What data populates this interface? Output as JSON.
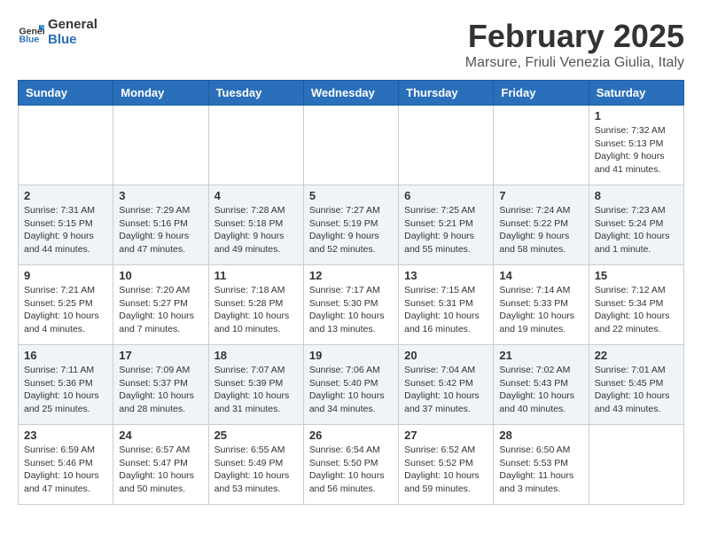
{
  "header": {
    "logo_general": "General",
    "logo_blue": "Blue",
    "month_title": "February 2025",
    "location": "Marsure, Friuli Venezia Giulia, Italy"
  },
  "days_of_week": [
    "Sunday",
    "Monday",
    "Tuesday",
    "Wednesday",
    "Thursday",
    "Friday",
    "Saturday"
  ],
  "weeks": [
    [
      {
        "day": "",
        "info": ""
      },
      {
        "day": "",
        "info": ""
      },
      {
        "day": "",
        "info": ""
      },
      {
        "day": "",
        "info": ""
      },
      {
        "day": "",
        "info": ""
      },
      {
        "day": "",
        "info": ""
      },
      {
        "day": "1",
        "info": "Sunrise: 7:32 AM\nSunset: 5:13 PM\nDaylight: 9 hours and 41 minutes."
      }
    ],
    [
      {
        "day": "2",
        "info": "Sunrise: 7:31 AM\nSunset: 5:15 PM\nDaylight: 9 hours and 44 minutes."
      },
      {
        "day": "3",
        "info": "Sunrise: 7:29 AM\nSunset: 5:16 PM\nDaylight: 9 hours and 47 minutes."
      },
      {
        "day": "4",
        "info": "Sunrise: 7:28 AM\nSunset: 5:18 PM\nDaylight: 9 hours and 49 minutes."
      },
      {
        "day": "5",
        "info": "Sunrise: 7:27 AM\nSunset: 5:19 PM\nDaylight: 9 hours and 52 minutes."
      },
      {
        "day": "6",
        "info": "Sunrise: 7:25 AM\nSunset: 5:21 PM\nDaylight: 9 hours and 55 minutes."
      },
      {
        "day": "7",
        "info": "Sunrise: 7:24 AM\nSunset: 5:22 PM\nDaylight: 9 hours and 58 minutes."
      },
      {
        "day": "8",
        "info": "Sunrise: 7:23 AM\nSunset: 5:24 PM\nDaylight: 10 hours and 1 minute."
      }
    ],
    [
      {
        "day": "9",
        "info": "Sunrise: 7:21 AM\nSunset: 5:25 PM\nDaylight: 10 hours and 4 minutes."
      },
      {
        "day": "10",
        "info": "Sunrise: 7:20 AM\nSunset: 5:27 PM\nDaylight: 10 hours and 7 minutes."
      },
      {
        "day": "11",
        "info": "Sunrise: 7:18 AM\nSunset: 5:28 PM\nDaylight: 10 hours and 10 minutes."
      },
      {
        "day": "12",
        "info": "Sunrise: 7:17 AM\nSunset: 5:30 PM\nDaylight: 10 hours and 13 minutes."
      },
      {
        "day": "13",
        "info": "Sunrise: 7:15 AM\nSunset: 5:31 PM\nDaylight: 10 hours and 16 minutes."
      },
      {
        "day": "14",
        "info": "Sunrise: 7:14 AM\nSunset: 5:33 PM\nDaylight: 10 hours and 19 minutes."
      },
      {
        "day": "15",
        "info": "Sunrise: 7:12 AM\nSunset: 5:34 PM\nDaylight: 10 hours and 22 minutes."
      }
    ],
    [
      {
        "day": "16",
        "info": "Sunrise: 7:11 AM\nSunset: 5:36 PM\nDaylight: 10 hours and 25 minutes."
      },
      {
        "day": "17",
        "info": "Sunrise: 7:09 AM\nSunset: 5:37 PM\nDaylight: 10 hours and 28 minutes."
      },
      {
        "day": "18",
        "info": "Sunrise: 7:07 AM\nSunset: 5:39 PM\nDaylight: 10 hours and 31 minutes."
      },
      {
        "day": "19",
        "info": "Sunrise: 7:06 AM\nSunset: 5:40 PM\nDaylight: 10 hours and 34 minutes."
      },
      {
        "day": "20",
        "info": "Sunrise: 7:04 AM\nSunset: 5:42 PM\nDaylight: 10 hours and 37 minutes."
      },
      {
        "day": "21",
        "info": "Sunrise: 7:02 AM\nSunset: 5:43 PM\nDaylight: 10 hours and 40 minutes."
      },
      {
        "day": "22",
        "info": "Sunrise: 7:01 AM\nSunset: 5:45 PM\nDaylight: 10 hours and 43 minutes."
      }
    ],
    [
      {
        "day": "23",
        "info": "Sunrise: 6:59 AM\nSunset: 5:46 PM\nDaylight: 10 hours and 47 minutes."
      },
      {
        "day": "24",
        "info": "Sunrise: 6:57 AM\nSunset: 5:47 PM\nDaylight: 10 hours and 50 minutes."
      },
      {
        "day": "25",
        "info": "Sunrise: 6:55 AM\nSunset: 5:49 PM\nDaylight: 10 hours and 53 minutes."
      },
      {
        "day": "26",
        "info": "Sunrise: 6:54 AM\nSunset: 5:50 PM\nDaylight: 10 hours and 56 minutes."
      },
      {
        "day": "27",
        "info": "Sunrise: 6:52 AM\nSunset: 5:52 PM\nDaylight: 10 hours and 59 minutes."
      },
      {
        "day": "28",
        "info": "Sunrise: 6:50 AM\nSunset: 5:53 PM\nDaylight: 11 hours and 3 minutes."
      },
      {
        "day": "",
        "info": ""
      }
    ]
  ]
}
